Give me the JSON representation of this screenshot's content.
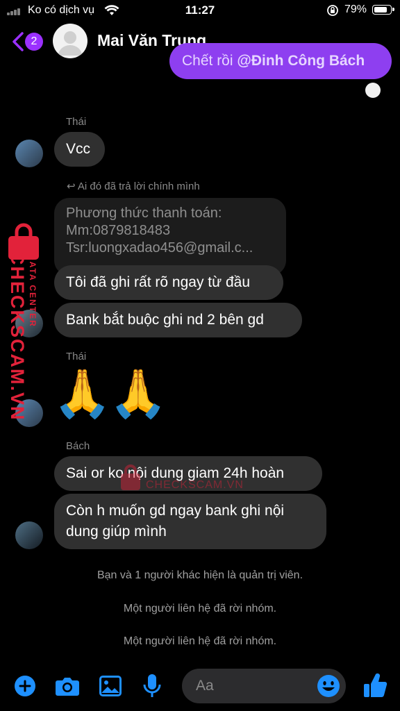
{
  "status_bar": {
    "carrier": "Ko có dịch vụ",
    "time": "11:27",
    "battery": "79%"
  },
  "header": {
    "unread_badge": "2",
    "contact_name": "Mai Văn Trung"
  },
  "messages": {
    "outgoing_partial": {
      "text_prefix": "Chết rồi ",
      "mention": "@Đinh Công Bách"
    },
    "group1": {
      "sender": "Thái",
      "text": "Vcc"
    },
    "reply_indicator": "Ai đó đã trả lời chính mình",
    "quoted": {
      "line1": "Phương thức thanh toán:",
      "line2": "Mm:0879818483",
      "line3": "Tsr:luongxadao456@gmail.c..."
    },
    "group2": {
      "msg1": "Tôi đã ghi rất rõ ngay từ đầu",
      "msg2": "Bank bắt buộc ghi nd 2 bên gd"
    },
    "group3": {
      "sender": "Thái",
      "emoji": "🙏🙏"
    },
    "group4": {
      "sender": "Bách",
      "msg1": "Sai or ko nội dung giam 24h hoàn",
      "msg2_line1": "Còn h muốn gd ngay bank ghi nội",
      "msg2_line2": "dung giúp mình"
    },
    "system": [
      "Bạn và 1 người khác hiện là quản trị viên.",
      "Một người liên hệ đã rời nhóm.",
      "Một người liên hệ đã rời nhóm."
    ]
  },
  "watermark": {
    "brand": "CHECKSCAM.VN",
    "sub": "DATA CENTER"
  },
  "composer": {
    "placeholder": "Aa"
  },
  "icons": [
    "plus-icon",
    "camera-icon",
    "gallery-icon",
    "mic-icon",
    "emoji-icon",
    "like-icon"
  ],
  "colors": {
    "accent": "#9b30ff",
    "bubble": "#303030",
    "icon_blue": "#1e90ff"
  }
}
